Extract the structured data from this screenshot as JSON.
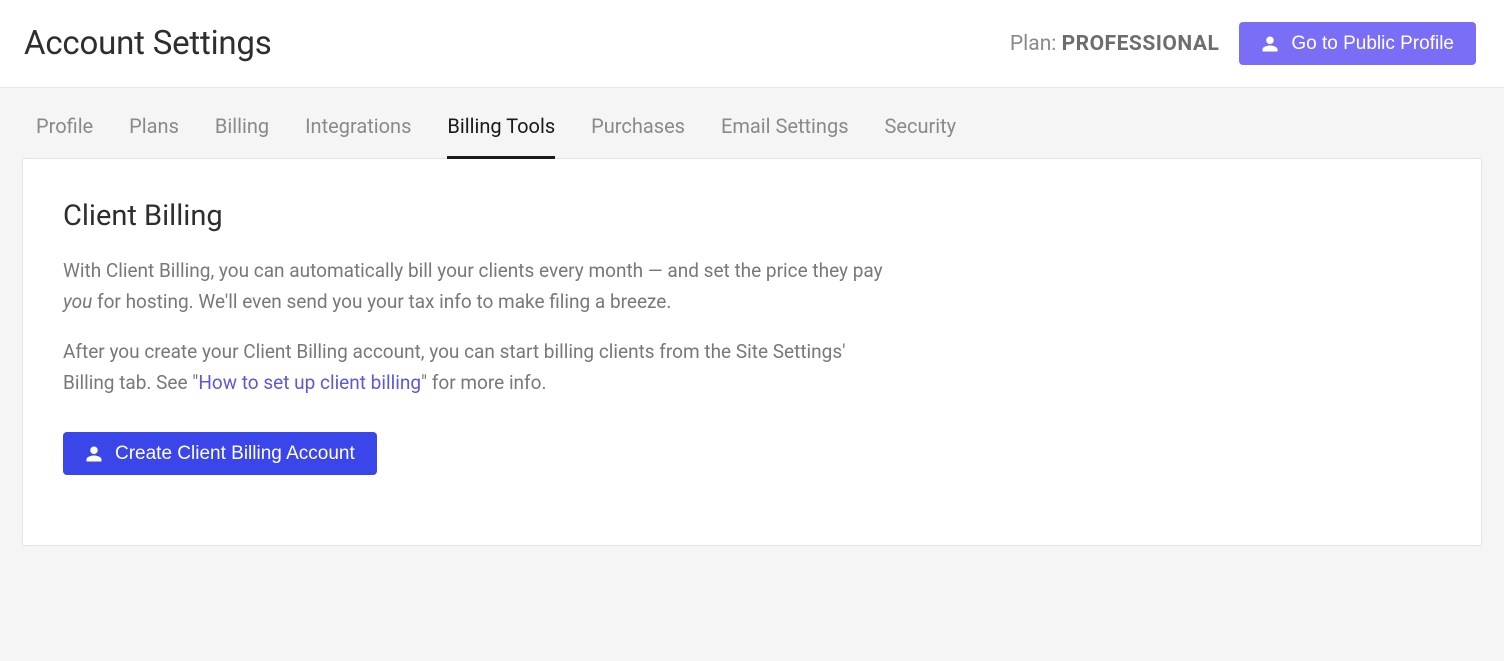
{
  "header": {
    "title": "Account Settings",
    "plan_label": "Plan: ",
    "plan_name": "PROFESSIONAL",
    "profile_button": "Go to Public Profile"
  },
  "tabs": [
    {
      "label": "Profile",
      "active": false
    },
    {
      "label": "Plans",
      "active": false
    },
    {
      "label": "Billing",
      "active": false
    },
    {
      "label": "Integrations",
      "active": false
    },
    {
      "label": "Billing Tools",
      "active": true
    },
    {
      "label": "Purchases",
      "active": false
    },
    {
      "label": "Email Settings",
      "active": false
    },
    {
      "label": "Security",
      "active": false
    }
  ],
  "client_billing": {
    "title": "Client Billing",
    "p1_a": "With Client Billing, you can automatically bill your clients every month — and set the price they pay ",
    "p1_em": "you",
    "p1_b": " for hosting. We'll even send you your tax info to make filing a breeze.",
    "p2_a": "After you create your Client Billing account, you can start billing clients from the Site Settings' Billing tab. See \"",
    "p2_link": "How to set up client billing",
    "p2_b": "\" for more info.",
    "create_button": "Create Client Billing Account"
  }
}
